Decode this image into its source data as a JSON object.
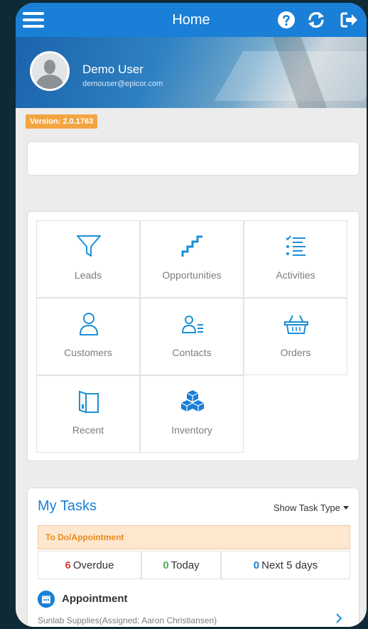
{
  "header": {
    "title": "Home",
    "icons": [
      "menu-icon",
      "help-icon",
      "refresh-icon",
      "logout-icon"
    ]
  },
  "profile": {
    "name": "Demo User",
    "email": "demouser@epicor.com"
  },
  "version_label": "Version: 2.0.1763",
  "menu_tiles": [
    {
      "label": "Leads",
      "icon": "funnel-icon"
    },
    {
      "label": "Opportunities",
      "icon": "stairs-icon"
    },
    {
      "label": "Activities",
      "icon": "checklist-icon"
    },
    {
      "label": "Customers",
      "icon": "person-icon"
    },
    {
      "label": "Contacts",
      "icon": "contact-list-icon"
    },
    {
      "label": "Orders",
      "icon": "basket-icon"
    },
    {
      "label": "Recent",
      "icon": "recent-book-icon"
    },
    {
      "label": "Inventory",
      "icon": "boxes-icon"
    }
  ],
  "tasks": {
    "title": "My Tasks",
    "filter_label": "Show Task Type",
    "category": "To Do/Appointment",
    "counts": [
      {
        "value": "6",
        "label": "Overdue",
        "color": "#e23b3b"
      },
      {
        "value": "0",
        "label": "Today",
        "color": "#4caf50"
      },
      {
        "value": "0",
        "label": "Next 5 days",
        "color": "#1a7fd6"
      }
    ],
    "item": {
      "title": "Appointment",
      "subtitle": "Sunlab Supplies(Assigned: Aaron Christiansen)"
    }
  },
  "colors": {
    "primary": "#1a7fd6",
    "version_badge": "#f2a541",
    "todo_band": "#fde7cf",
    "todo_text": "#e88b1d"
  }
}
